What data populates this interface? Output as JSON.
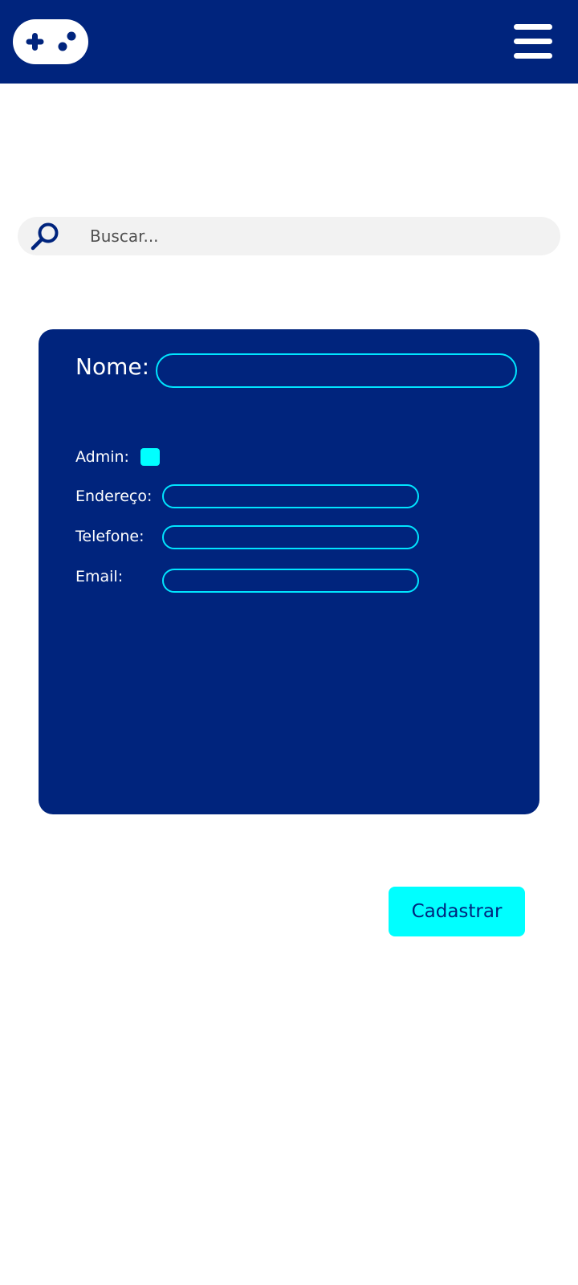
{
  "header": {
    "logo_icon": "gamepad-icon",
    "menu_icon": "hamburger-menu-icon"
  },
  "search": {
    "icon": "search-icon",
    "placeholder": "Buscar..."
  },
  "form": {
    "nome_label": "Nome:",
    "nome_value": "",
    "admin_label": "Admin:",
    "admin_checked": true,
    "endereco_label": "Endereço:",
    "endereco_value": "",
    "telefone_label": "Telefone:",
    "telefone_value": "",
    "email_label": "Email:",
    "email_value": ""
  },
  "actions": {
    "submit_label": "Cadastrar"
  },
  "colors": {
    "primary": "#00247d",
    "accent": "#00ffff",
    "field_border": "#00e5ff",
    "search_bg": "#f2f2f2",
    "background": "#ffffff"
  }
}
